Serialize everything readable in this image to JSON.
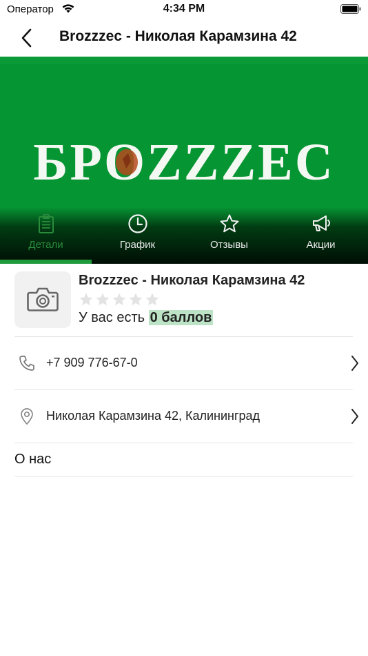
{
  "status_bar": {
    "carrier": "Оператор",
    "time": "4:34 PM"
  },
  "header": {
    "title": "Brozzzec - Николая Карамзина 42",
    "back_icon": "chevron-left-icon"
  },
  "hero": {
    "logo_text": "БРOZZZEC",
    "background_color": "#069533"
  },
  "tabs": [
    {
      "label": "Детали",
      "icon": "list-icon",
      "active": true
    },
    {
      "label": "График",
      "icon": "clock-icon",
      "active": false
    },
    {
      "label": "Отзывы",
      "icon": "star-icon",
      "active": false
    },
    {
      "label": "Акции",
      "icon": "megaphone-icon",
      "active": false
    }
  ],
  "company": {
    "name": "Brozzzec - Николая Карамзина 42",
    "rating": 0,
    "rating_max": 5,
    "points_prefix": "У вас есть",
    "points_value": "0 баллов",
    "avatar_icon": "camera-icon"
  },
  "contacts": {
    "phone": "+7 909 776-67-0",
    "address": "Николая Карамзина 42, Калининград"
  },
  "about": {
    "title": "О нас"
  },
  "colors": {
    "accent": "#1f9a3d",
    "points_highlight": "#bde3c6"
  }
}
